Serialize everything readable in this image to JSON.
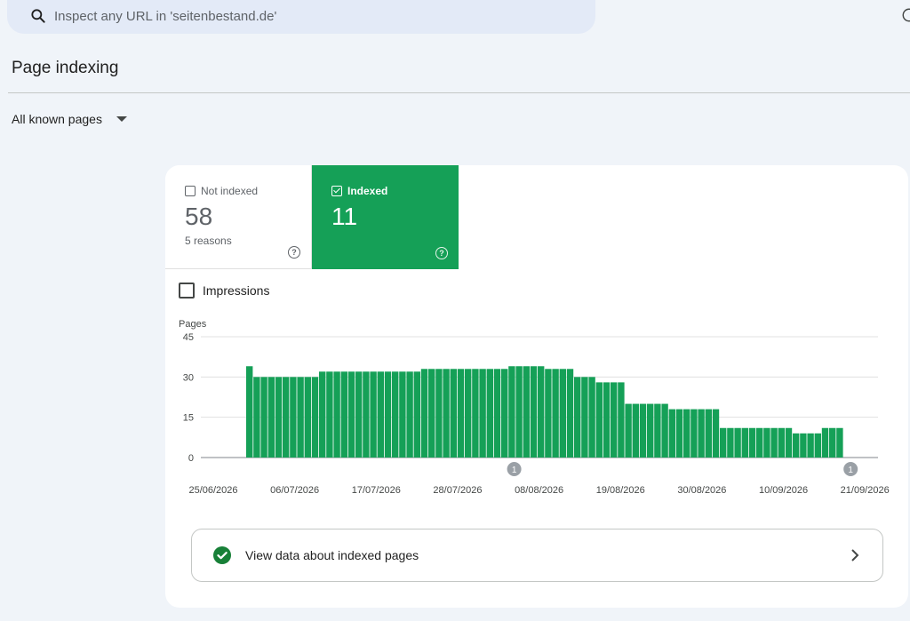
{
  "search": {
    "placeholder": "Inspect any URL in 'seitenbestand.de'"
  },
  "page": {
    "title": "Page indexing",
    "filter_label": "All known pages"
  },
  "summary": {
    "not_indexed": {
      "label": "Not indexed",
      "value": "58",
      "sub": "5 reasons"
    },
    "indexed": {
      "label": "Indexed",
      "value": "11"
    }
  },
  "impressions_label": "Impressions",
  "link_row": {
    "label": "View data about indexed pages"
  },
  "colors": {
    "indexed": "#15a057",
    "background": "#f0f4f9",
    "card": "#ffffff"
  },
  "chart_data": {
    "type": "bar",
    "ylabel": "Pages",
    "yticks": [
      0,
      15,
      30,
      45
    ],
    "ylim": [
      0,
      45
    ],
    "xtick_labels": [
      "25/06/2026",
      "06/07/2026",
      "17/07/2026",
      "28/07/2026",
      "08/08/2026",
      "19/08/2026",
      "30/08/2026",
      "10/09/2026",
      "21/09/2026"
    ],
    "annotations": [
      {
        "label": "1",
        "date": "08/08/2026"
      },
      {
        "label": "1",
        "date": "21/09/2026"
      }
    ],
    "series": [
      {
        "values": [
          34,
          30,
          30,
          30,
          30,
          30,
          30,
          30,
          30,
          30,
          32,
          32,
          32,
          32,
          32,
          32,
          32,
          32,
          32,
          32,
          32,
          32,
          32,
          32,
          33,
          33,
          33,
          33,
          33,
          33,
          33,
          33,
          33,
          33,
          33,
          33,
          34,
          34,
          34,
          34,
          34,
          33,
          33,
          33,
          33,
          30,
          30,
          30,
          28,
          28,
          28,
          28,
          20,
          20,
          20,
          20,
          20,
          20,
          18,
          18,
          18,
          18,
          18,
          18,
          18,
          11,
          11,
          11,
          11,
          11,
          11,
          11,
          11,
          11,
          11,
          9,
          9,
          9,
          9,
          11,
          11,
          11
        ]
      }
    ]
  }
}
